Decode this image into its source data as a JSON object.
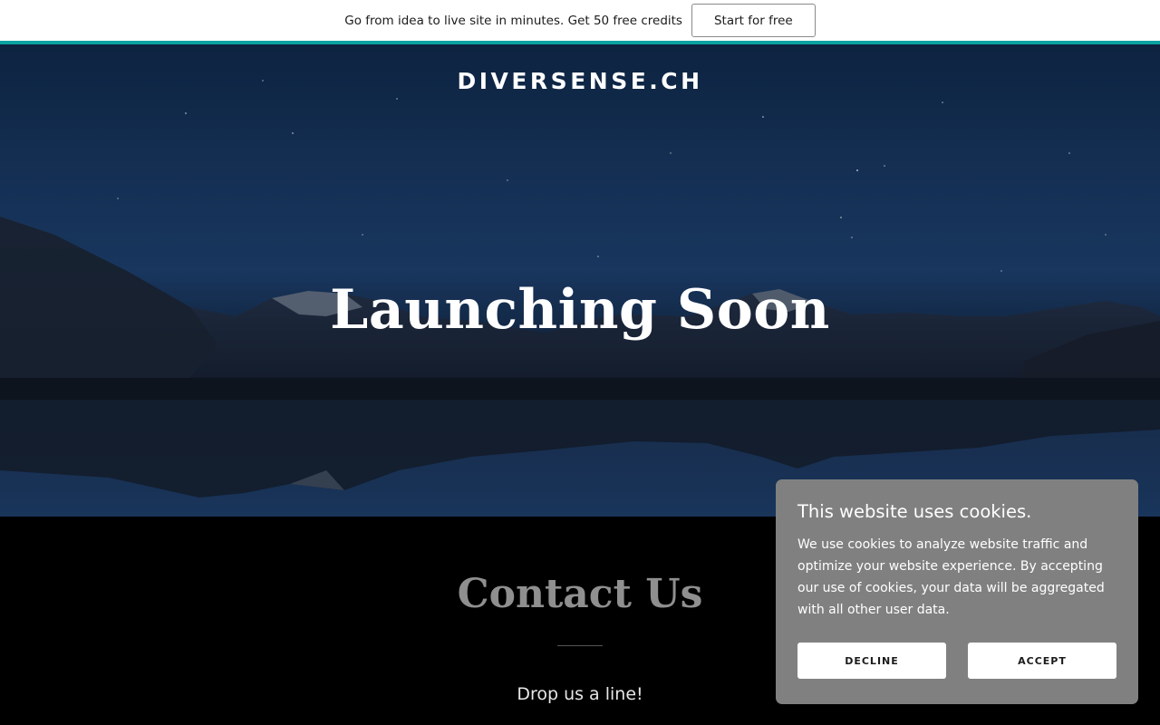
{
  "promo": {
    "text": "Go from idea to live site in minutes. Get 50 free credits",
    "button_label": "Start for free"
  },
  "hero": {
    "site_title": "DIVERSENSE.CH",
    "heading": "Launching Soon"
  },
  "contact": {
    "heading": "Contact Us",
    "subheading": "Drop us a line!"
  },
  "cookie_banner": {
    "title": "This website uses cookies.",
    "text": "We use cookies to analyze website traffic and optimize your website experience. By accepting our use of cookies, your data will be aggregated with all other user data.",
    "decline_label": "DECLINE",
    "accept_label": "ACCEPT"
  },
  "colors": {
    "accent_line": "#09a3a0",
    "cookie_panel": "#808080"
  }
}
